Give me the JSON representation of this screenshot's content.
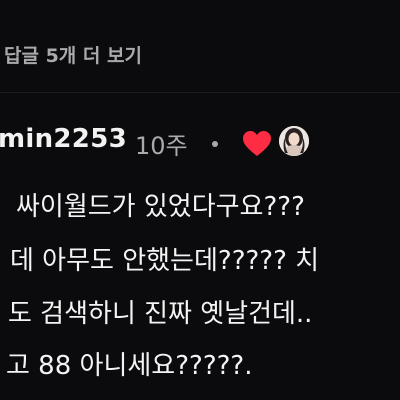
{
  "replies": {
    "more_label": "답글 5개 더 보기"
  },
  "comment": {
    "username": "min2253",
    "timestamp": "10주",
    "lines": [
      "싸이월드가 있었다구요???",
      "데 아무도 안했는데????? 치",
      "도 검색하니 진짜 옛날건데..",
      "고 88 아니세요?????."
    ]
  },
  "icons": {
    "like": "heart-icon",
    "author_like_avatar": "avatar"
  },
  "colors": {
    "background": "#0b0b0d",
    "heart": "#ff2d44",
    "secondary_text": "#a9a9ae",
    "primary_text": "#f4f4f4"
  }
}
